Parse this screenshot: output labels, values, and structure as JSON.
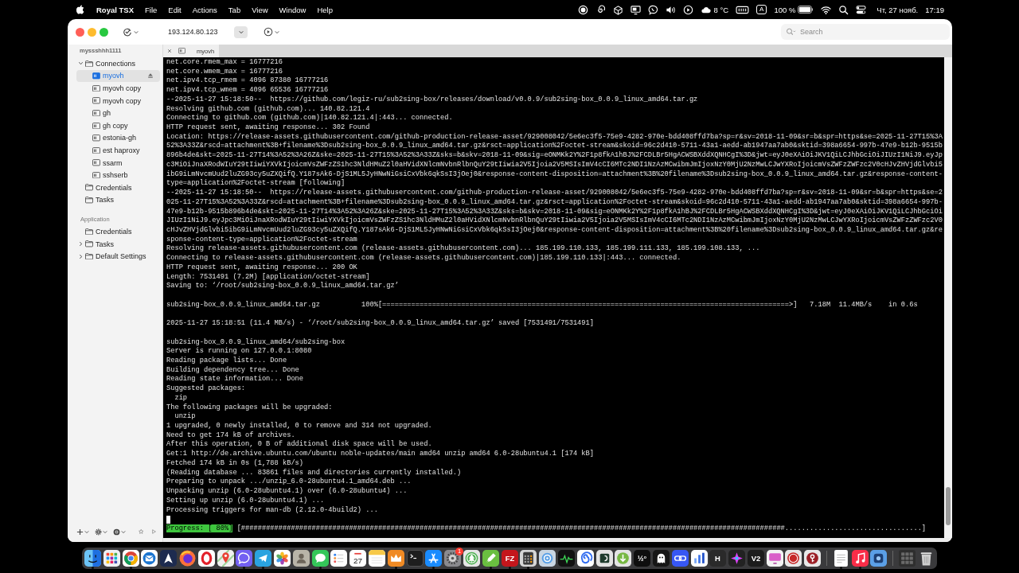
{
  "menu_bar": {
    "app_name": "Royal TSX",
    "menus": [
      "File",
      "Edit",
      "Actions",
      "Tab",
      "View",
      "Window",
      "Help"
    ],
    "temperature": "8 °C",
    "input_source": "A",
    "battery": "100 %",
    "date": "Чт, 27 нояб.",
    "time": "17:19"
  },
  "toolbar": {
    "host": "193.124.80.123",
    "search": {
      "placeholder": "Search"
    }
  },
  "sidebar": {
    "document": "myssshhh1111",
    "tree": [
      {
        "label": "Connections",
        "kind": "folder",
        "expanded": true,
        "selected": false,
        "children": [
          {
            "label": "myovh",
            "kind": "connection",
            "selected": true,
            "connected": true
          },
          {
            "label": "myovh copy",
            "kind": "connection",
            "selected": false,
            "connected": false
          },
          {
            "label": "myovh copy",
            "kind": "connection",
            "selected": false,
            "connected": false
          },
          {
            "label": "gh",
            "kind": "connection",
            "selected": false,
            "connected": false
          },
          {
            "label": "gh copy",
            "kind": "connection",
            "selected": false,
            "connected": false
          },
          {
            "label": "estonia-gh",
            "kind": "connection",
            "selected": false,
            "connected": false
          },
          {
            "label": "est haproxy",
            "kind": "connection",
            "selected": false,
            "connected": false
          },
          {
            "label": "ssarm",
            "kind": "connection",
            "selected": false,
            "connected": false
          },
          {
            "label": "sshserb",
            "kind": "connection",
            "selected": false,
            "connected": false
          }
        ]
      },
      {
        "label": "Credentials",
        "kind": "folder",
        "selected": false
      },
      {
        "label": "Tasks",
        "kind": "folder",
        "selected": false
      }
    ],
    "section": "Application",
    "app_tree": [
      {
        "label": "Credentials",
        "kind": "folder",
        "selected": false
      },
      {
        "label": "Tasks",
        "kind": "folder",
        "expanded": false,
        "selected": false
      },
      {
        "label": "Default Settings",
        "kind": "folder",
        "expanded": false,
        "selected": false
      }
    ]
  },
  "tabs": [
    {
      "label": "myovh",
      "selected": true
    }
  ],
  "terminal": {
    "blocks": [
      [
        "net.core.rmem_max = 16777216",
        "net.core.wmem_max = 16777216",
        "net.ipv4.tcp_rmem = 4096 87380 16777216",
        "net.ipv4.tcp_wmem = 4096 65536 16777216",
        "--2025-11-27 15:18:50--  https://github.com/legiz-ru/sub2sing-box/releases/download/v0.0.9/sub2sing-box_0.0.9_linux_amd64.tar.gz",
        "Resolving github.com (github.com)... 140.82.121.4",
        "Connecting to github.com (github.com)|140.82.121.4|:443... connected.",
        "HTTP request sent, awaiting response... 302 Found",
        "Location: https://release-assets.githubusercontent.com/github-production-release-asset/929008042/5e6ec3f5-75e9-4282-970e-bdd408ffd7ba?sp=r&sv=2018-11-09&sr=b&spr=https&se=2025-11-27T15%3A52%3A33Z&rscd=attachment%3B+filename%3Dsub2sing-box_0.0.9_linux_amd64.tar.gz&rsct=application%2Foctet-stream&skoid=96c2d410-5711-43a1-aedd-ab1947aa7ab0&sktid=398a6654-997b-47e9-b12b-9515b896b4de&skt=2025-11-27T14%3A52%3A26Z&ske=2025-11-27T15%3A52%3A33Z&sks=b&skv=2018-11-09&sig=eONMKk2Y%2F1p8fkA1hBJ%2FCDLBr5HgACWSBXddXQNHCgI%3D&jwt=eyJ0eXAiOiJKV1QiLCJhbGciOiJIUzI1NiJ9.eyJpc3MiOiJnaXRodWIuY29tIiwiYXVkIjoicmVsZWFzZS1hc3NldHMuZ2l0aHVidXNlcmNvbnRlbnQuY29tIiwia2V5Ijoia2V5MSIsImV4cCI6MTc2NDI1NzAzMCwibmJmIjoxNzY0MjU2NzMwLCJwYXRoIjoicmVsZWFzZWFzc2V0cHJvZHVjdGlvbi5ibG9iLmNvcmUud2luZG93cy5uZXQifQ.Y187sAk6-DjS1ML5JyHNwNiGsiCxVbk6qkSsI3jOej0&response-content-disposition=attachment%3B%20filename%3Dsub2sing-box_0.0.9_linux_amd64.tar.gz&response-content-type=application%2Foctet-stream [following]",
        "--2025-11-27 15:18:50--  https://release-assets.githubusercontent.com/github-production-release-asset/929008042/5e6ec3f5-75e9-4282-970e-bdd408ffd7ba?sp=r&sv=2018-11-09&sr=b&spr=https&se=2025-11-27T15%3A52%3A33Z&rscd=attachment%3B+filename%3Dsub2sing-box_0.0.9_linux_amd64.tar.gz&rsct=application%2Foctet-stream&skoid=96c2d410-5711-43a1-aedd-ab1947aa7ab0&sktid=398a6654-997b-47e9-b12b-9515b896b4de&skt=2025-11-27T14%3A52%3A26Z&ske=2025-11-27T15%3A52%3A33Z&sks=b&skv=2018-11-09&sig=eONMKk2Y%2F1p8fkA1hBJ%2FCDLBr5HgACWSBXddXQNHCgI%3D&jwt=eyJ0eXAiOiJKV1QiLCJhbGciOiJIUzI1NiJ9.eyJpc3MiOiJnaXRodWIuY29tIiwiYXVkIjoicmVsZWFzZS1hc3NldHMuZ2l0aHVidXNlcmNvbnRlbnQuY29tIiwia2V5Ijoia2V5MSIsImV4cCI6MTc2NDI1NzAzMCwibmJmIjoxNzY0MjU2NzMwLCJwYXRoIjoicmVsZWFzZWFzc2V0cHJvZHVjdGlvbi5ibG9iLmNvcmUud2luZG93cy5uZXQifQ.Y187sAk6-DjS1ML5JyHNwNiGsiCxVbk6qkSsI3jOej0&response-content-disposition=attachment%3B%20filename%3Dsub2sing-box_0.0.9_linux_amd64.tar.gz&response-content-type=application%2Foctet-stream",
        "Resolving release-assets.githubusercontent.com (release-assets.githubusercontent.com)... 185.199.110.133, 185.199.111.133, 185.199.108.133, ...",
        "Connecting to release-assets.githubusercontent.com (release-assets.githubusercontent.com)|185.199.110.133|:443... connected.",
        "HTTP request sent, awaiting response... 200 OK",
        "Length: 7531491 (7.2M) [application/octet-stream]",
        "Saving to: ‘/root/sub2sing-box_0.0.9_linux_amd64.tar.gz’"
      ],
      [
        "sub2sing-box_0.0.9_linux_amd64.tar.gz          100%[==================================================================================================>]   7.18M  11.4MB/s    in 0.6s"
      ],
      [
        "2025-11-27 15:18:51 (11.4 MB/s) - ‘/root/sub2sing-box_0.0.9_linux_amd64.tar.gz’ saved [7531491/7531491]"
      ],
      [
        "sub2sing-box_0.0.9_linux_amd64/sub2sing-box",
        "Server is running on 127.0.0.1:8080",
        "Reading package lists... Done",
        "Building dependency tree... Done",
        "Reading state information... Done",
        "Suggested packages:",
        "  zip",
        "The following packages will be upgraded:",
        "  unzip",
        "1 upgraded, 0 newly installed, 0 to remove and 314 not upgraded.",
        "Need to get 174 kB of archives.",
        "After this operation, 0 B of additional disk space will be used.",
        "Get:1 http://de.archive.ubuntu.com/ubuntu noble-updates/main amd64 unzip amd64 6.0-28ubuntu4.1 [174 kB]",
        "Fetched 174 kB in 0s (1,788 kB/s)",
        "(Reading database ... 83861 files and directories currently installed.)",
        "Preparing to unpack .../unzip_6.0-28ubuntu4.1_amd64.deb ...",
        "Unpacking unzip (6.0-28ubuntu4.1) over (6.0-28ubuntu4) ...",
        "Setting up unzip (6.0-28ubuntu4.1) ...",
        "Processing triggers for man-db (2.12.0-4build2) ..."
      ]
    ],
    "progress": {
      "label": "Progress: [ 80%]",
      "bar": "[###################################################################################################################################.................................]"
    }
  },
  "dock": {
    "items": [
      {
        "running": true
      },
      {
        "running": false
      },
      {
        "running": true
      },
      {
        "running": false
      },
      {
        "running": false
      },
      {
        "running": false
      },
      {
        "running": false
      },
      {
        "running": false
      },
      {
        "running": true
      },
      {
        "running": true
      },
      {
        "running": false
      },
      {
        "running": false
      },
      {
        "running": true
      },
      {
        "running": false
      },
      {
        "running": false,
        "label": "27"
      },
      {
        "running": false
      },
      {
        "running": true
      },
      {
        "running": false
      },
      {
        "running": true
      },
      {
        "running": false,
        "badge": "1"
      },
      {
        "running": false
      },
      {
        "running": true
      },
      {
        "running": true,
        "label": "FZ"
      },
      {
        "running": true
      },
      {
        "running": false
      },
      {
        "running": false
      },
      {
        "running": false
      },
      {
        "running": false
      },
      {
        "running": false
      },
      {
        "running": false,
        "label": "½°"
      },
      {
        "running": false
      },
      {
        "running": false
      },
      {
        "running": false
      },
      {
        "running": false,
        "label": "H"
      },
      {
        "running": false
      },
      {
        "running": false,
        "label": "V2"
      },
      {
        "running": false
      },
      {
        "running": false
      },
      {
        "running": false
      },
      {
        "running": true
      },
      {
        "running": true
      },
      {
        "running": false
      },
      {
        "running": false
      },
      {
        "running": false
      }
    ]
  }
}
